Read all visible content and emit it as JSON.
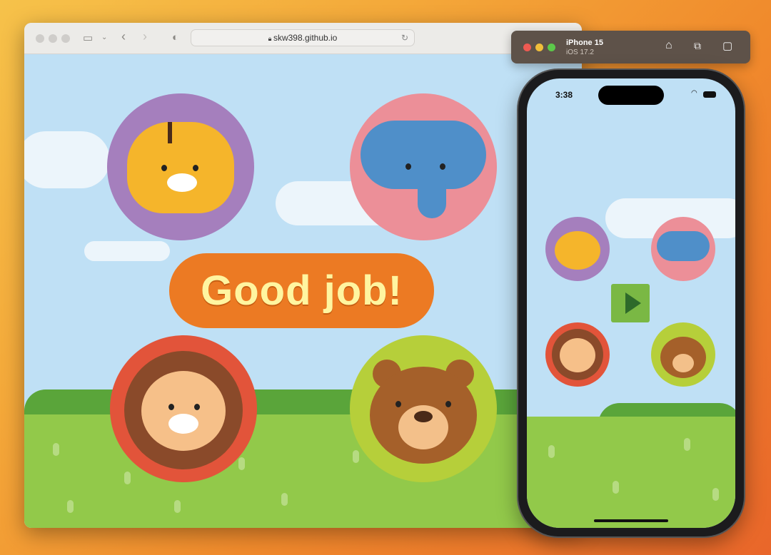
{
  "browser": {
    "url": "skw398.github.io",
    "icons": [
      "sidebar-icon",
      "chevron-down-icon",
      "back-icon",
      "forward-icon",
      "shield-icon",
      "lock-icon",
      "reload-icon"
    ]
  },
  "game": {
    "message": "Good job!",
    "animals": [
      "tiger",
      "elephant",
      "lion",
      "bear"
    ],
    "play_icon": "play-icon"
  },
  "simulator": {
    "device": "iPhone 15",
    "os": "iOS 17.2",
    "icons": [
      "home-icon",
      "screenshot-icon",
      "rotate-icon"
    ]
  },
  "phone": {
    "time": "3:38"
  },
  "colors": {
    "tiger_bg": "#a57fbd",
    "elephant_bg": "#ec8f98",
    "lion_bg": "#e2543a",
    "bear_bg": "#b6cf3a",
    "message_bg": "#ec7a23",
    "message_text": "#fff5a0",
    "sky": "#bfe0f5",
    "grass": "#92c94a"
  }
}
